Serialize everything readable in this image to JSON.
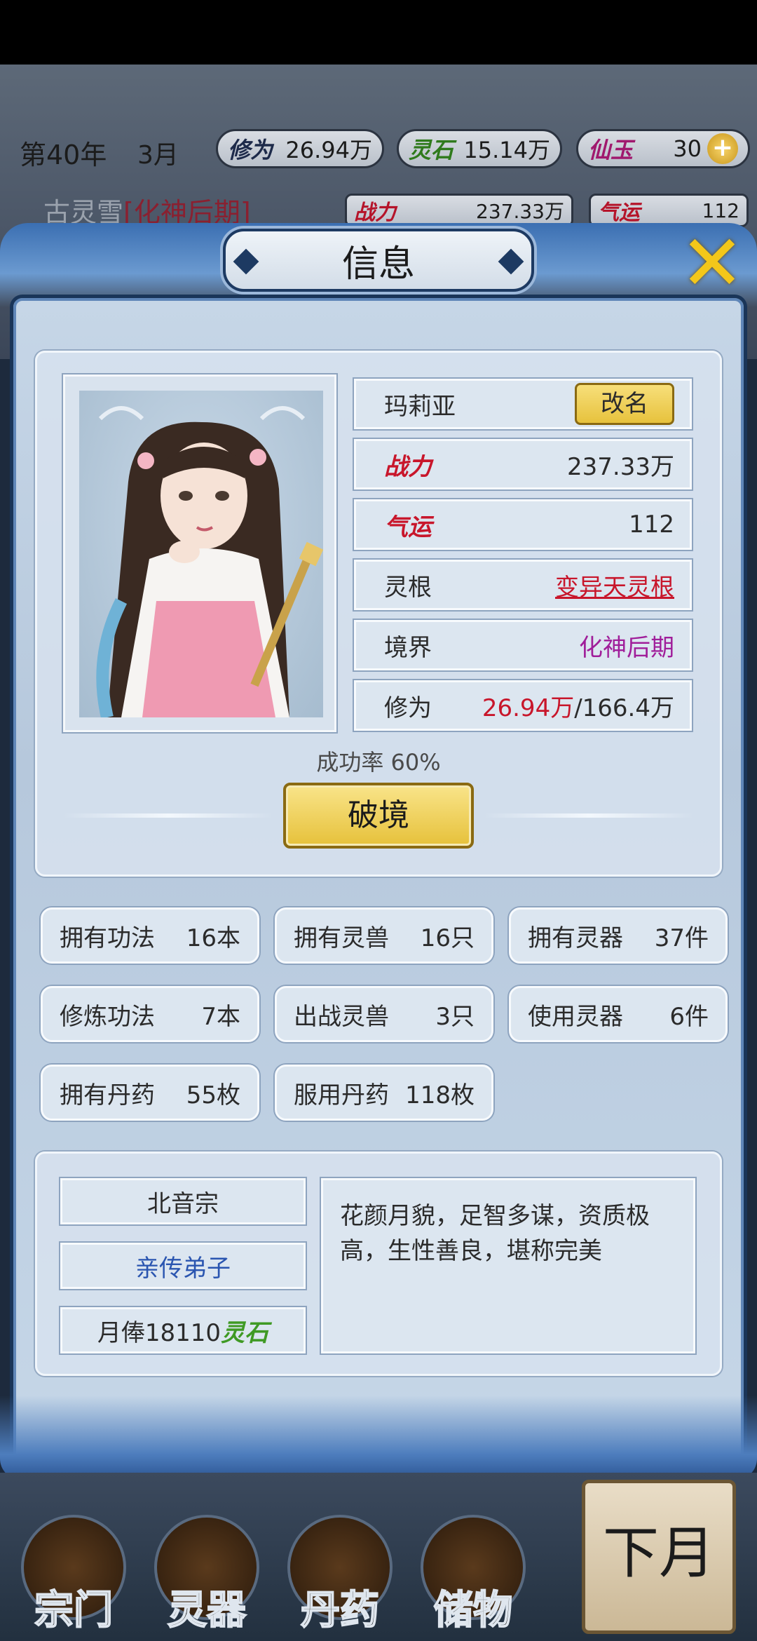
{
  "hud": {
    "year": "第40年",
    "month": "3月",
    "cultivation_label": "修为",
    "cultivation_value": "26.94万",
    "spirit_stone_label": "灵石",
    "spirit_stone_value": "15.14万",
    "jade_label": "仙玉",
    "jade_value": "30",
    "plus": "+",
    "character_name": "古灵雪",
    "character_realm": "[化神后期]",
    "power_label": "战力",
    "power_value": "237.33万",
    "luck_label": "气运",
    "luck_value": "112"
  },
  "modal": {
    "title": "信息",
    "close": "✕"
  },
  "profile": {
    "name": "玛莉亚",
    "rename_button": "改名",
    "power_label": "战力",
    "power_value": "237.33万",
    "luck_label": "气运",
    "luck_value": "112",
    "root_label": "灵根",
    "root_value": "变异天灵根",
    "realm_label": "境界",
    "realm_value": "化神后期",
    "cultivation_label": "修为",
    "cultivation_current": "26.94万",
    "cultivation_max": "/166.4万",
    "success_rate": "成功率 60%",
    "break_button": "破境"
  },
  "stats": [
    {
      "label": "拥有功法",
      "value": "16本"
    },
    {
      "label": "拥有灵兽",
      "value": "16只"
    },
    {
      "label": "拥有灵器",
      "value": "37件"
    },
    {
      "label": "修炼功法",
      "value": "7本"
    },
    {
      "label": "出战灵兽",
      "value": "3只"
    },
    {
      "label": "使用灵器",
      "value": "6件"
    },
    {
      "label": "拥有丹药",
      "value": "55枚"
    },
    {
      "label": "服用丹药",
      "value": "118枚"
    }
  ],
  "sect": {
    "name": "北音宗",
    "rank": "亲传弟子",
    "salary_prefix": "月俸18110",
    "salary_unit": "灵石",
    "description": "花颜月貌，足智多谋，资质极高，生性善良，堪称完美"
  },
  "nav": {
    "items": [
      "宗门",
      "灵器",
      "丹药",
      "储物"
    ],
    "next_month": "下月"
  },
  "colors": {
    "accent_red": "#c8162b",
    "realm_purple": "#a01e9a",
    "rank_blue": "#2a55b0",
    "gold_button": "#e6c13a",
    "spirit_green": "#3f9a24"
  }
}
